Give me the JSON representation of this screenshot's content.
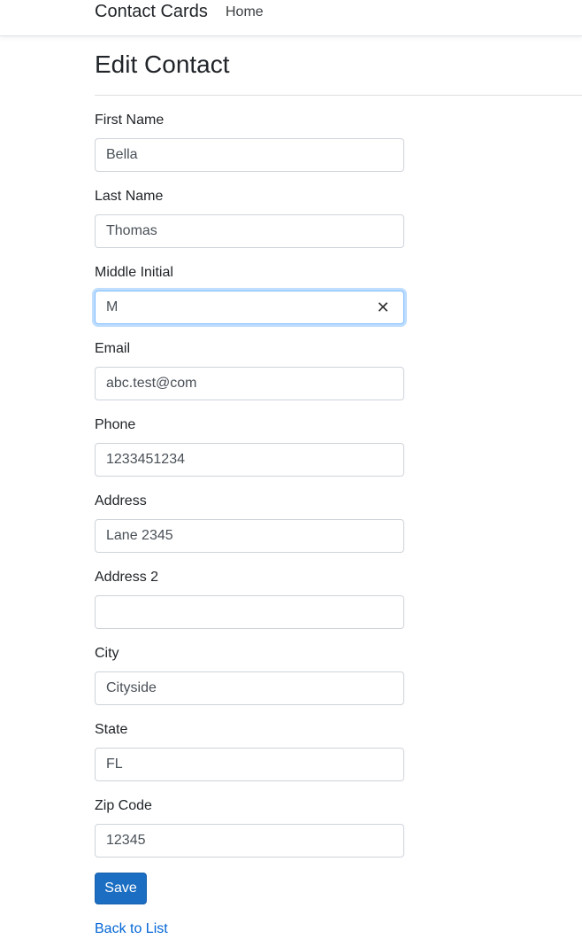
{
  "navbar": {
    "brand": "Contact Cards",
    "links": [
      {
        "label": "Home"
      }
    ]
  },
  "page": {
    "title": "Edit Contact"
  },
  "form": {
    "fields": [
      {
        "label": "First Name",
        "value": "Bella"
      },
      {
        "label": "Last Name",
        "value": "Thomas"
      },
      {
        "label": "Middle Initial",
        "value": "M",
        "focused": true,
        "clear_icon": "close-icon"
      },
      {
        "label": "Email",
        "value": "abc.test@com"
      },
      {
        "label": "Phone",
        "value": "1233451234"
      },
      {
        "label": "Address",
        "value": "Lane 2345"
      },
      {
        "label": "Address 2",
        "value": ""
      },
      {
        "label": "City",
        "value": "Cityside"
      },
      {
        "label": "State",
        "value": "FL"
      },
      {
        "label": "Zip Code",
        "value": "12345"
      }
    ],
    "save_label": "Save",
    "back_link": "Back to List"
  },
  "colors": {
    "primary": "#1b6ec2",
    "link": "#0366d6",
    "focus_border": "#80bdff"
  }
}
